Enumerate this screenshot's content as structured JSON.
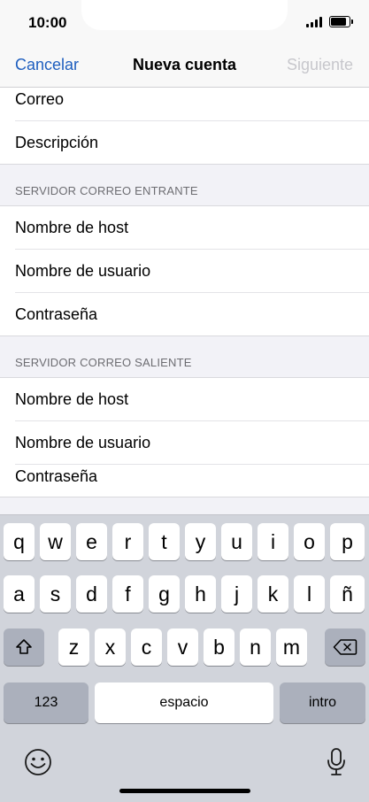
{
  "status": {
    "time": "10:00"
  },
  "nav": {
    "cancel": "Cancelar",
    "title": "Nueva cuenta",
    "next": "Siguiente"
  },
  "form": {
    "top_rows": [
      "Correo",
      "Descripción"
    ],
    "incoming_header": "SERVIDOR CORREO ENTRANTE",
    "incoming_rows": [
      "Nombre de host",
      "Nombre de usuario",
      "Contraseña"
    ],
    "outgoing_header": "SERVIDOR CORREO SALIENTE",
    "outgoing_rows": [
      "Nombre de host",
      "Nombre de usuario",
      "Contraseña"
    ]
  },
  "keyboard": {
    "row1": [
      "q",
      "w",
      "e",
      "r",
      "t",
      "y",
      "u",
      "i",
      "o",
      "p"
    ],
    "row2": [
      "a",
      "s",
      "d",
      "f",
      "g",
      "h",
      "j",
      "k",
      "l",
      "ñ"
    ],
    "row3": [
      "z",
      "x",
      "c",
      "v",
      "b",
      "n",
      "m"
    ],
    "numbers": "123",
    "space": "espacio",
    "return": "intro",
    "shift_icon": "shift-icon",
    "delete_icon": "delete-icon",
    "emoji_icon": "emoji-icon",
    "mic_icon": "microphone-icon"
  },
  "colors": {
    "accent": "#1f5fbf",
    "disabled": "#c7c7cc",
    "keyboard_bg": "#d1d4db"
  }
}
